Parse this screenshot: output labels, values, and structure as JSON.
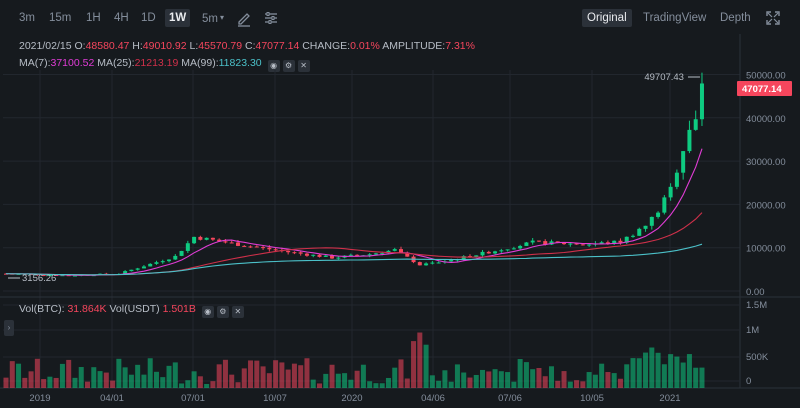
{
  "toolbar": {
    "timeframes": [
      "3m",
      "15m",
      "1H",
      "4H",
      "1D",
      "1W"
    ],
    "interval_dropdown": "5m",
    "views": [
      "Original",
      "TradingView",
      "Depth"
    ]
  },
  "info": {
    "date": "2021/02/15",
    "o_label": "O:",
    "o": "48580.47",
    "h_label": "H:",
    "h": "49010.92",
    "l_label": "L:",
    "l": "45570.79",
    "c_label": "C:",
    "c": "47077.14",
    "change_label": "CHANGE:",
    "change": "0.01%",
    "amp_label": "AMPLITUDE:",
    "amp": "7.31%"
  },
  "ma": {
    "ma7_label": "MA(7):",
    "ma7": "37100.52",
    "ma25_label": "MA(25):",
    "ma25": "21213.19",
    "ma99_label": "MA(99):",
    "ma99": "11823.30"
  },
  "price_axis": [
    "50000.00",
    "40000.00",
    "30000.00",
    "20000.00",
    "10000.00",
    "0.00"
  ],
  "high_marker": "49707.43",
  "low_marker": "3156.26",
  "current_price": "47077.14",
  "volume": {
    "btc_label": "Vol(BTC):",
    "btc": "31.864K",
    "usdt_label": "Vol(USDT)",
    "usdt": "1.501B",
    "axis": [
      "1.5M",
      "1M",
      "500K",
      "0"
    ]
  },
  "x_axis": [
    "2019",
    "04/01",
    "07/01",
    "10/07",
    "2020",
    "04/06",
    "07/06",
    "10/05",
    "2021"
  ],
  "colors": {
    "up": "#0ecb81",
    "down": "#f6465d",
    "ma7": "#e13cd6",
    "ma25": "#cf304a",
    "ma99": "#4bc0c8",
    "bg": "#161a1e"
  }
}
